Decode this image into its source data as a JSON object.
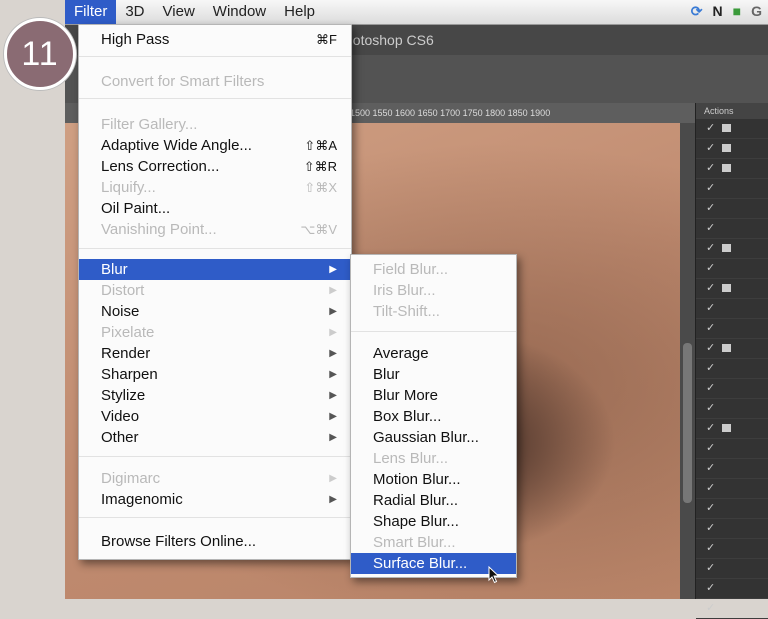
{
  "step_badge": "11",
  "menubar": {
    "items": [
      "Filter",
      "3D",
      "View",
      "Window",
      "Help"
    ],
    "active": "Filter",
    "tray": [
      "N",
      "G"
    ]
  },
  "app": {
    "title": "hotoshop CS6",
    "ruler_text": "1500  1550  1600  1650  1700  1750  1800  1850  1900",
    "panel_title": "Actions"
  },
  "filter_menu": {
    "items": [
      {
        "label": "High Pass",
        "shortcut": "⌘F",
        "state": "enabled"
      },
      {
        "label": "Convert for Smart Filters",
        "shortcut": "",
        "state": "disabled"
      },
      {
        "label": "Filter Gallery...",
        "shortcut": "",
        "state": "disabled"
      },
      {
        "label": "Adaptive Wide Angle...",
        "shortcut": "⇧⌘A",
        "state": "enabled"
      },
      {
        "label": "Lens Correction...",
        "shortcut": "⇧⌘R",
        "state": "enabled"
      },
      {
        "label": "Liquify...",
        "shortcut": "⇧⌘X",
        "state": "disabled"
      },
      {
        "label": "Oil Paint...",
        "shortcut": "",
        "state": "enabled"
      },
      {
        "label": "Vanishing Point...",
        "shortcut": "⌥⌘V",
        "state": "disabled"
      },
      {
        "label": "Blur",
        "shortcut": "",
        "state": "highlighted",
        "submenu": true
      },
      {
        "label": "Distort",
        "shortcut": "",
        "state": "disabled",
        "submenu": true
      },
      {
        "label": "Noise",
        "shortcut": "",
        "state": "enabled",
        "submenu": true
      },
      {
        "label": "Pixelate",
        "shortcut": "",
        "state": "disabled",
        "submenu": true
      },
      {
        "label": "Render",
        "shortcut": "",
        "state": "enabled",
        "submenu": true
      },
      {
        "label": "Sharpen",
        "shortcut": "",
        "state": "enabled",
        "submenu": true
      },
      {
        "label": "Stylize",
        "shortcut": "",
        "state": "enabled",
        "submenu": true
      },
      {
        "label": "Video",
        "shortcut": "",
        "state": "enabled",
        "submenu": true
      },
      {
        "label": "Other",
        "shortcut": "",
        "state": "enabled",
        "submenu": true
      },
      {
        "label": "Digimarc",
        "shortcut": "",
        "state": "disabled",
        "submenu": true
      },
      {
        "label": "Imagenomic",
        "shortcut": "",
        "state": "enabled",
        "submenu": true
      },
      {
        "label": "Browse Filters Online...",
        "shortcut": "",
        "state": "enabled"
      }
    ]
  },
  "blur_submenu": {
    "items": [
      {
        "label": "Field Blur...",
        "state": "disabled"
      },
      {
        "label": "Iris Blur...",
        "state": "disabled"
      },
      {
        "label": "Tilt-Shift...",
        "state": "disabled"
      },
      {
        "label": "Average",
        "state": "enabled"
      },
      {
        "label": "Blur",
        "state": "enabled"
      },
      {
        "label": "Blur More",
        "state": "enabled"
      },
      {
        "label": "Box Blur...",
        "state": "enabled"
      },
      {
        "label": "Gaussian Blur...",
        "state": "enabled"
      },
      {
        "label": "Lens Blur...",
        "state": "disabled"
      },
      {
        "label": "Motion Blur...",
        "state": "enabled"
      },
      {
        "label": "Radial Blur...",
        "state": "enabled"
      },
      {
        "label": "Shape Blur...",
        "state": "enabled"
      },
      {
        "label": "Smart Blur...",
        "state": "disabled"
      },
      {
        "label": "Surface Blur...",
        "state": "highlighted"
      }
    ]
  }
}
